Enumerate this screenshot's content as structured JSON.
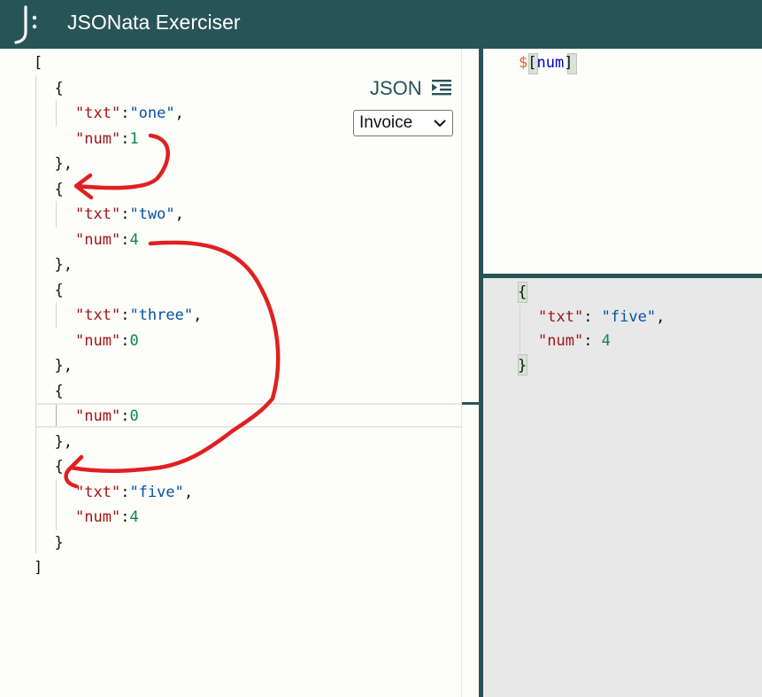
{
  "app": {
    "title": "JSONata Exerciser",
    "logo": "jsonata-logo-icon"
  },
  "input_pane": {
    "format_label": "JSON",
    "format_icon": "indent-format-icon",
    "sample_select": {
      "selected": "Invoice"
    },
    "lines": [
      {
        "indent": 0,
        "tokens": [
          {
            "t": "punc",
            "v": "["
          }
        ]
      },
      {
        "indent": 1,
        "tokens": [
          {
            "t": "punc",
            "v": "{"
          }
        ]
      },
      {
        "indent": 2,
        "tokens": [
          {
            "t": "key",
            "v": "\"txt\""
          },
          {
            "t": "punc",
            "v": ":"
          },
          {
            "t": "str",
            "v": "\"one\""
          },
          {
            "t": "punc",
            "v": ","
          }
        ]
      },
      {
        "indent": 2,
        "tokens": [
          {
            "t": "key",
            "v": "\"num\""
          },
          {
            "t": "punc",
            "v": ":"
          },
          {
            "t": "num",
            "v": "1"
          }
        ]
      },
      {
        "indent": 1,
        "tokens": [
          {
            "t": "punc",
            "v": "},"
          }
        ]
      },
      {
        "indent": 1,
        "tokens": [
          {
            "t": "punc",
            "v": "{"
          }
        ]
      },
      {
        "indent": 2,
        "tokens": [
          {
            "t": "key",
            "v": "\"txt\""
          },
          {
            "t": "punc",
            "v": ":"
          },
          {
            "t": "str",
            "v": "\"two\""
          },
          {
            "t": "punc",
            "v": ","
          }
        ]
      },
      {
        "indent": 2,
        "tokens": [
          {
            "t": "key",
            "v": "\"num\""
          },
          {
            "t": "punc",
            "v": ":"
          },
          {
            "t": "num",
            "v": "4"
          }
        ]
      },
      {
        "indent": 1,
        "tokens": [
          {
            "t": "punc",
            "v": "},"
          }
        ]
      },
      {
        "indent": 1,
        "tokens": [
          {
            "t": "punc",
            "v": "{"
          }
        ]
      },
      {
        "indent": 2,
        "tokens": [
          {
            "t": "key",
            "v": "\"txt\""
          },
          {
            "t": "punc",
            "v": ":"
          },
          {
            "t": "str",
            "v": "\"three\""
          },
          {
            "t": "punc",
            "v": ","
          }
        ]
      },
      {
        "indent": 2,
        "tokens": [
          {
            "t": "key",
            "v": "\"num\""
          },
          {
            "t": "punc",
            "v": ":"
          },
          {
            "t": "num",
            "v": "0"
          }
        ]
      },
      {
        "indent": 1,
        "tokens": [
          {
            "t": "punc",
            "v": "},"
          }
        ]
      },
      {
        "indent": 1,
        "tokens": [
          {
            "t": "punc",
            "v": "{"
          }
        ]
      },
      {
        "indent": 2,
        "tokens": [
          {
            "t": "key",
            "v": "\"num\""
          },
          {
            "t": "punc",
            "v": ":"
          },
          {
            "t": "num",
            "v": "0"
          }
        ]
      },
      {
        "indent": 1,
        "tokens": [
          {
            "t": "punc",
            "v": "},"
          }
        ]
      },
      {
        "indent": 1,
        "tokens": [
          {
            "t": "punc",
            "v": "{"
          }
        ]
      },
      {
        "indent": 2,
        "tokens": [
          {
            "t": "key",
            "v": "\"txt\""
          },
          {
            "t": "punc",
            "v": ":"
          },
          {
            "t": "str",
            "v": "\"five\""
          },
          {
            "t": "punc",
            "v": ","
          }
        ]
      },
      {
        "indent": 2,
        "tokens": [
          {
            "t": "key",
            "v": "\"num\""
          },
          {
            "t": "punc",
            "v": ":"
          },
          {
            "t": "num",
            "v": "4"
          }
        ]
      },
      {
        "indent": 1,
        "tokens": [
          {
            "t": "punc",
            "v": "}"
          }
        ]
      },
      {
        "indent": 0,
        "tokens": [
          {
            "t": "punc",
            "v": "]"
          }
        ]
      }
    ]
  },
  "query_pane": {
    "tokens": [
      {
        "t": "dollar",
        "v": "$"
      },
      {
        "t": "punc",
        "v": "["
      },
      {
        "t": "qname",
        "v": "num"
      },
      {
        "t": "punc",
        "v": "]"
      }
    ]
  },
  "result_pane": {
    "lines": [
      {
        "indent": 0,
        "tokens": [
          {
            "t": "punc",
            "v": "{"
          }
        ]
      },
      {
        "indent": 1,
        "tokens": [
          {
            "t": "key",
            "v": "\"txt\""
          },
          {
            "t": "punc",
            "v": ": "
          },
          {
            "t": "str",
            "v": "\"five\""
          },
          {
            "t": "punc",
            "v": ","
          }
        ]
      },
      {
        "indent": 1,
        "tokens": [
          {
            "t": "key",
            "v": "\"num\""
          },
          {
            "t": "punc",
            "v": ": "
          },
          {
            "t": "num",
            "v": "4"
          }
        ]
      },
      {
        "indent": 0,
        "tokens": [
          {
            "t": "punc",
            "v": "}"
          }
        ]
      }
    ]
  },
  "annotation": {
    "color": "#e02020"
  },
  "colors": {
    "header": "#275457",
    "key": "#a31515",
    "string": "#0451a5",
    "number": "#098658"
  }
}
